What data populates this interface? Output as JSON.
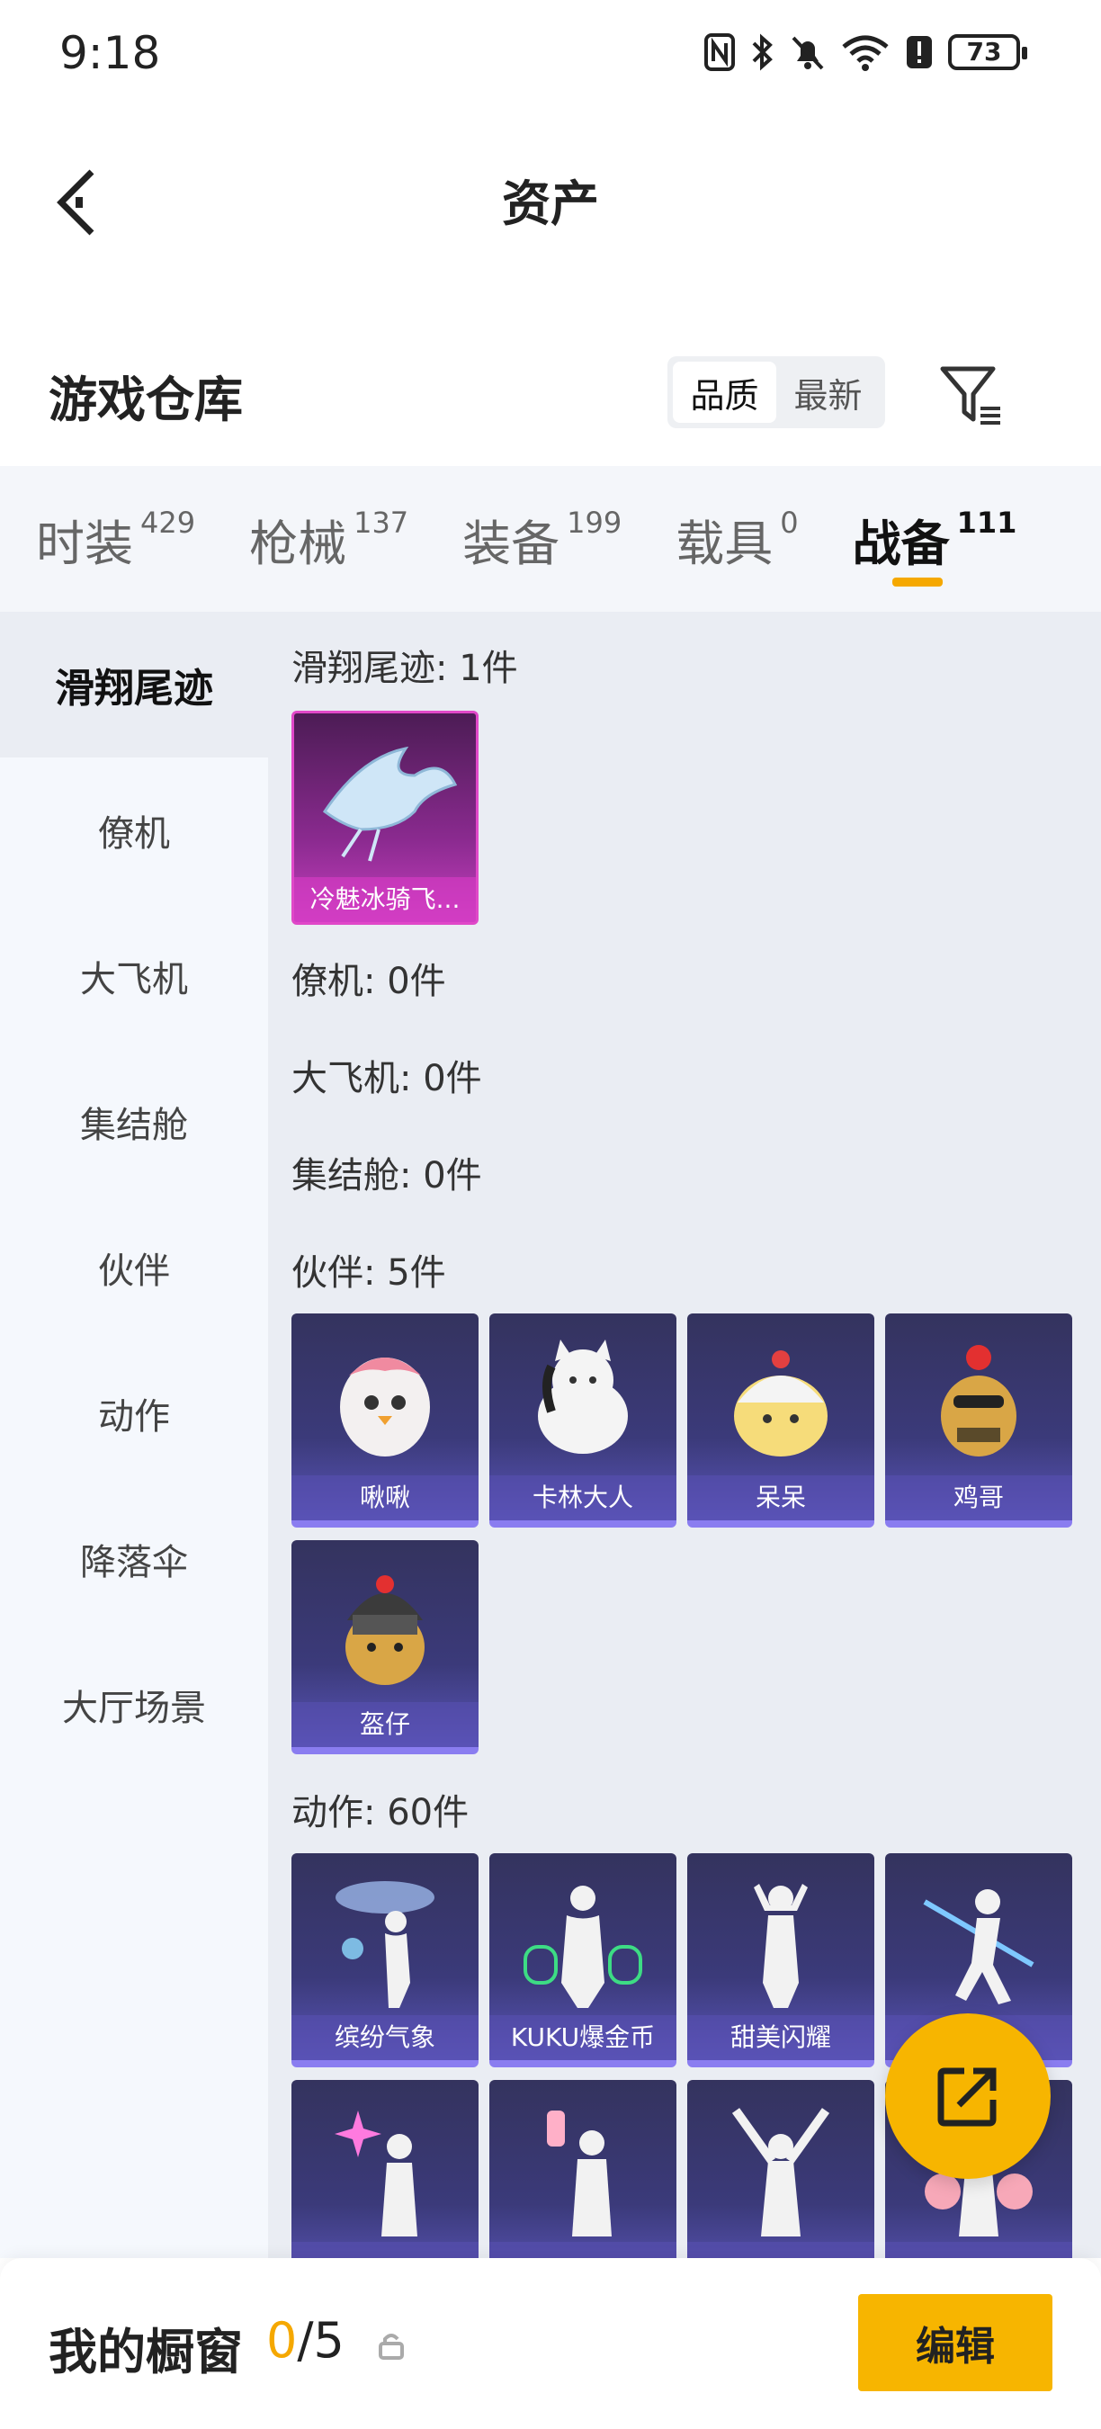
{
  "status": {
    "time": "9:18",
    "battery": "73"
  },
  "header": {
    "title": "资产"
  },
  "warehouse": {
    "title": "游戏仓库",
    "sort_quality": "品质",
    "sort_newest": "最新"
  },
  "tabs": [
    {
      "label": "时装",
      "count": "429"
    },
    {
      "label": "枪械",
      "count": "137"
    },
    {
      "label": "装备",
      "count": "199"
    },
    {
      "label": "载具",
      "count": "0"
    },
    {
      "label": "战备",
      "count": "111"
    }
  ],
  "sidebar": {
    "items": [
      "滑翔尾迹",
      "僚机",
      "大飞机",
      "集结舱",
      "伙伴",
      "动作",
      "降落伞",
      "大厅场景"
    ]
  },
  "sections": {
    "glide": {
      "title": "滑翔尾迹: 1件",
      "items": [
        "冷魅冰骑飞..."
      ]
    },
    "wingman": {
      "title": "僚机: 0件"
    },
    "plane": {
      "title": "大飞机: 0件"
    },
    "pod": {
      "title": "集结舱: 0件"
    },
    "partner": {
      "title": "伙伴: 5件",
      "items": [
        "啾啾",
        "卡林大人",
        "呆呆",
        "鸡哥",
        "盔仔"
      ]
    },
    "action": {
      "title": "动作: 60件",
      "items": [
        "缤纷气象",
        "KUKU爆金币",
        "甜美闪耀"
      ]
    }
  },
  "bottom": {
    "title": "我的橱窗",
    "current": "0",
    "total": "/5",
    "edit_label": "编辑"
  },
  "colors": {
    "accent": "#f7b500",
    "card_purple": "#3b3a7a",
    "card_pink": "#c43fbd"
  }
}
